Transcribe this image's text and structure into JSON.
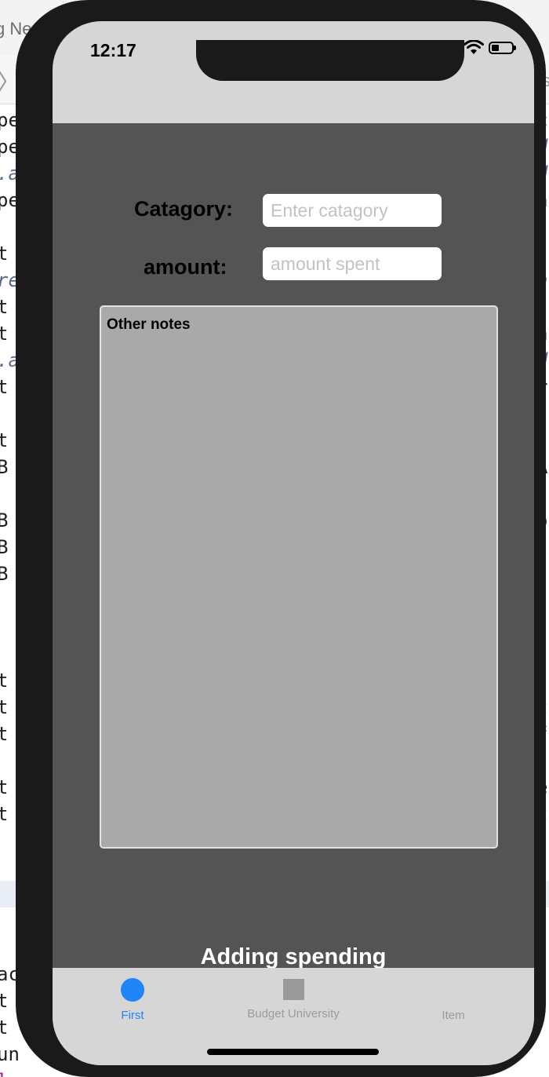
{
  "background_editor": {
    "window_title": "g Ne",
    "left_fragments": [
      "pe",
      "pe",
      ".a",
      "pe",
      "t",
      "re",
      "t",
      "t",
      ".a",
      "t",
      "t",
      "B",
      "B",
      "B",
      "B",
      "t",
      "t",
      "t",
      "t",
      "t",
      "ac",
      "t",
      "t",
      "un",
      "l."
    ],
    "right_fragments": [
      "c",
      "d",
      "d",
      "a",
      "n",
      "a",
      "d",
      "r",
      "A",
      "o",
      "l",
      ".",
      "t",
      "f",
      "e",
      "t"
    ],
    "nav_right_fragment": "s"
  },
  "status_bar": {
    "time": "12:17"
  },
  "form": {
    "category_label": "Catagory:",
    "category_placeholder": "Enter catagory",
    "amount_label": "amount:",
    "amount_placeholder": "amount spent",
    "notes_text": "Other notes",
    "submit_label": "Adding spending"
  },
  "tab_bar": {
    "tabs": [
      {
        "label": "First",
        "icon": "circle-icon",
        "active": true
      },
      {
        "label": "Budget University",
        "icon": "square-icon",
        "active": false
      },
      {
        "label": "Item",
        "icon": "",
        "active": false
      }
    ]
  },
  "colors": {
    "accent": "#1f84f7",
    "content_bg": "#545454",
    "notes_bg": "#a9a9a9",
    "bar_bg": "#d6d6d6"
  }
}
